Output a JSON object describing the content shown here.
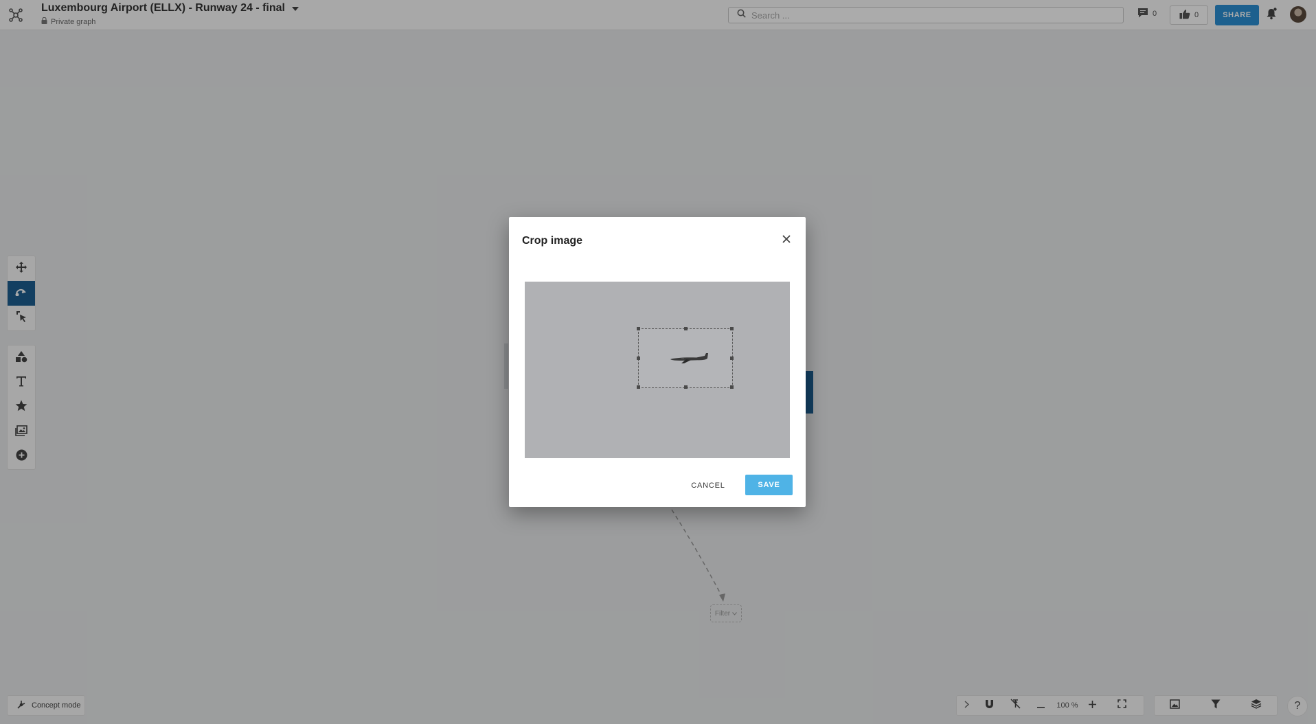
{
  "header": {
    "title": "Luxembourg Airport (ELLX) - Runway 24 - final",
    "subtitle": "Private graph",
    "search_placeholder": "Search ...",
    "comments_count": "0",
    "likes_count": "0",
    "share_label": "SHARE"
  },
  "toolbar": {
    "tools": [
      {
        "icon": "move-icon"
      },
      {
        "icon": "connect-icon",
        "active": true
      },
      {
        "icon": "select-icon"
      }
    ],
    "insert_tools": [
      {
        "icon": "shapes-icon"
      },
      {
        "icon": "text-icon"
      },
      {
        "icon": "star-icon"
      },
      {
        "icon": "image-icon"
      },
      {
        "icon": "add-icon"
      }
    ]
  },
  "canvas": {
    "filter_label": "Filter"
  },
  "bottom_bar": {
    "concept_mode_label": "Concept mode",
    "zoom_level": "100 %"
  },
  "dialog": {
    "title": "Crop image",
    "cancel_label": "CANCEL",
    "save_label": "SAVE"
  },
  "colors": {
    "accent": "#2c8fd4",
    "save_button": "#4fb3e6",
    "active_tool": "#1d5f91"
  }
}
